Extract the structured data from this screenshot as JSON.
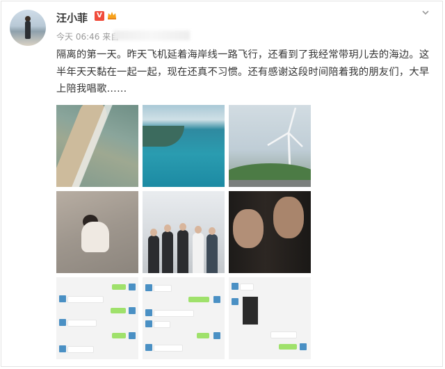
{
  "post": {
    "username": "汪小菲",
    "time": "今天 06:46",
    "source_prefix": "来自",
    "text": "隔离的第一天。昨天飞机延着海岸线一路飞行，还看到了我经常带玥儿去的海边。这半年天天黏在一起一起，现在还真不习惯。还有感谢这段时间陪着我的朋友们，大早上陪我唱歌……"
  },
  "icons": {
    "verified": "verified-v-icon",
    "member": "crown-member-icon",
    "menu": "chevron-down-icon"
  },
  "colors": {
    "verified_badge": "#f04c3b",
    "meta_text": "#999999",
    "body_text": "#333333"
  },
  "photos": [
    {
      "label": "aerial-coastline"
    },
    {
      "label": "aerial-sea"
    },
    {
      "label": "wind-turbine"
    },
    {
      "label": "child-on-beach"
    },
    {
      "label": "group-of-men"
    },
    {
      "label": "selfie-two-men"
    },
    {
      "label": "chat-screenshot-1"
    },
    {
      "label": "chat-screenshot-2"
    },
    {
      "label": "chat-screenshot-3"
    }
  ]
}
